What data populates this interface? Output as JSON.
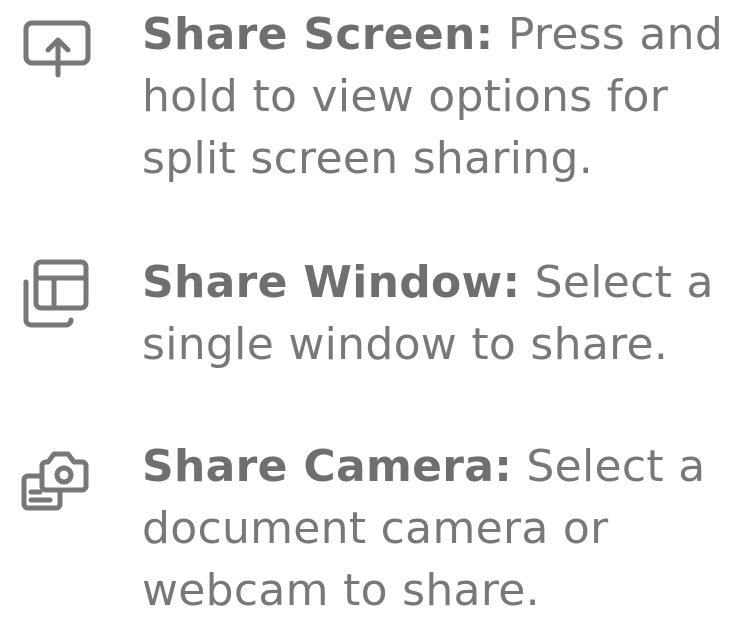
{
  "colors": {
    "text": "#787878",
    "title": "#6f6f6f",
    "icon": "#777777",
    "background": "#ffffff"
  },
  "items": [
    {
      "icon": "share-screen-icon",
      "title": "Share Screen:",
      "description": " Press and hold to view options for split screen sharing."
    },
    {
      "icon": "share-window-icon",
      "title": "Share Window:",
      "description": " Select a single window to share."
    },
    {
      "icon": "share-camera-icon",
      "title": "Share Camera:",
      "description": " Select a document camera or webcam to share."
    }
  ]
}
